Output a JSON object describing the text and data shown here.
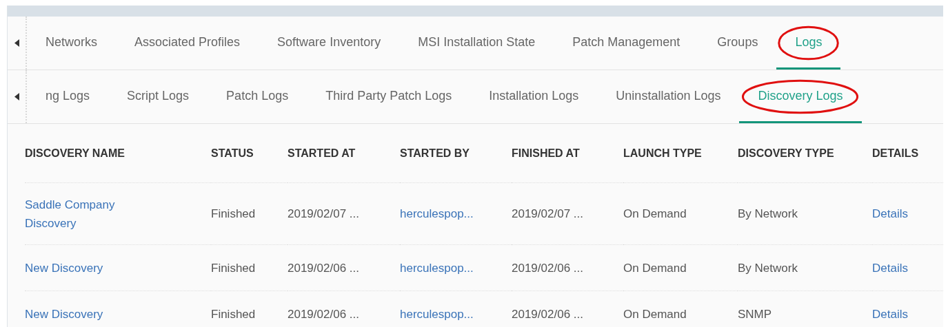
{
  "main_tabs": [
    {
      "label": "Networks",
      "selected": false,
      "annotated": false
    },
    {
      "label": "Associated Profiles",
      "selected": false,
      "annotated": false
    },
    {
      "label": "Software Inventory",
      "selected": false,
      "annotated": false
    },
    {
      "label": "MSI Installation State",
      "selected": false,
      "annotated": false
    },
    {
      "label": "Patch Management",
      "selected": false,
      "annotated": false
    },
    {
      "label": "Groups",
      "selected": false,
      "annotated": false
    },
    {
      "label": "Logs",
      "selected": true,
      "annotated": true
    }
  ],
  "log_tabs": [
    {
      "label": "ng Logs",
      "selected": false,
      "annotated": false
    },
    {
      "label": "Script Logs",
      "selected": false,
      "annotated": false
    },
    {
      "label": "Patch Logs",
      "selected": false,
      "annotated": false
    },
    {
      "label": "Third Party Patch Logs",
      "selected": false,
      "annotated": false
    },
    {
      "label": "Installation Logs",
      "selected": false,
      "annotated": false
    },
    {
      "label": "Uninstallation Logs",
      "selected": false,
      "annotated": false
    },
    {
      "label": "Discovery Logs",
      "selected": true,
      "annotated": true
    }
  ],
  "table": {
    "columns": [
      "DISCOVERY NAME",
      "STATUS",
      "STARTED AT",
      "STARTED BY",
      "FINISHED AT",
      "LAUNCH TYPE",
      "DISCOVERY TYPE",
      "DETAILS"
    ],
    "rows": [
      [
        "Saddle Company Discovery",
        "Finished",
        "2019/02/07 ...",
        "herculespop...",
        "2019/02/07 ...",
        "On Demand",
        "By Network",
        "Details"
      ],
      [
        "New Discovery",
        "Finished",
        "2019/02/06 ...",
        "herculespop...",
        "2019/02/06 ...",
        "On Demand",
        "By Network",
        "Details"
      ],
      [
        "New Discovery",
        "Finished",
        "2019/02/06 ...",
        "herculespop...",
        "2019/02/06 ...",
        "On Demand",
        "SNMP",
        "Details"
      ]
    ]
  }
}
